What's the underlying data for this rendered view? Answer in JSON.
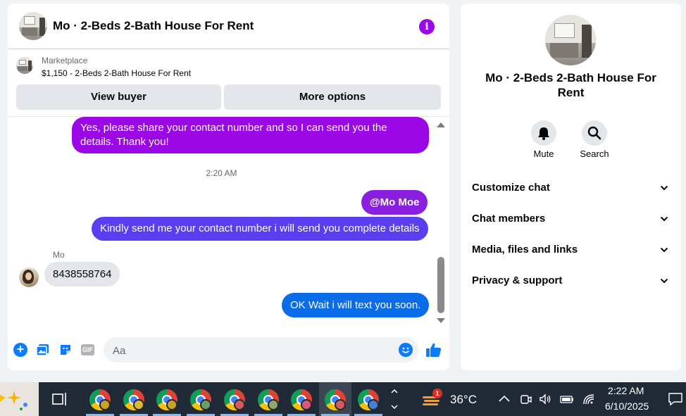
{
  "chat": {
    "title": "Mo · 2-Beds 2-Bath House For Rent",
    "marketplace_label": "Marketplace",
    "listing": "$1,150 - 2-Beds 2-Bath House For Rent",
    "view_buyer": "View buyer",
    "more_options": "More options"
  },
  "messages": {
    "m1": "Yes, please share your contact number and so I can send you the details. Thank you!",
    "timestamp": "2:20 AM",
    "m2": "@Mo Moe",
    "m3": "Kindly send me your contact number i will send you complete details",
    "sender": "Mo",
    "m4": "8438558764",
    "m5": "OK Wait i will text you soon."
  },
  "composer": {
    "placeholder": "Aa",
    "gif": "GIF"
  },
  "info_panel": {
    "name": "Mo · 2-Beds 2-Bath House For Rent",
    "mute": "Mute",
    "search": "Search",
    "sections": [
      "Customize chat",
      "Chat members",
      "Media, files and links",
      "Privacy & support"
    ]
  },
  "taskbar": {
    "weather_badge": "1",
    "temperature": "36°C",
    "time": "2:22 AM",
    "date": "6/10/2025"
  },
  "colors": {
    "accent_purple": "#9b08e5",
    "outgoing_blue": "#0b6ce8",
    "messenger_blue": "#0a7cff"
  }
}
